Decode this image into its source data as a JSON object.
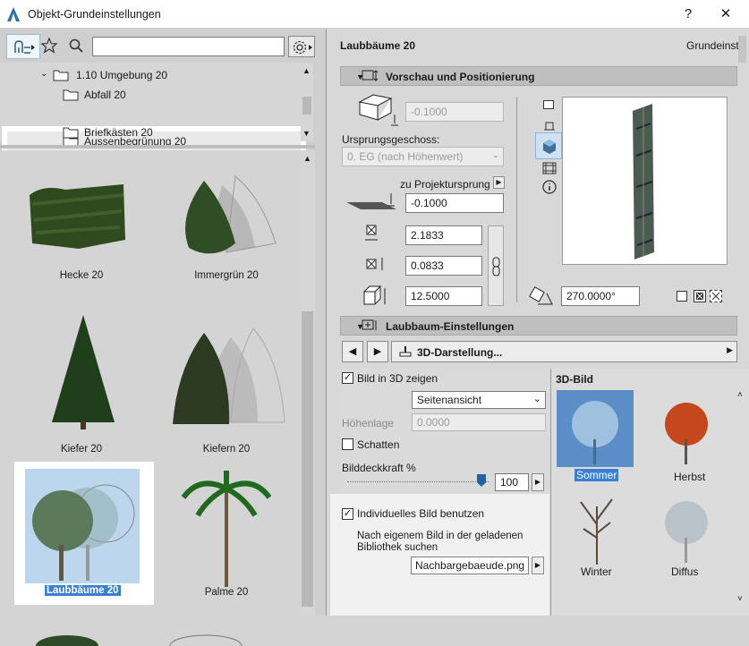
{
  "window": {
    "title": "Objekt-Grundeinstellungen",
    "help": "?",
    "close": "✕"
  },
  "left": {
    "tree": [
      {
        "label": "1.10 Umgebung 20"
      },
      {
        "label": "Abfall 20"
      },
      {
        "label": "Aussenbegrünung 20"
      },
      {
        "label": "Briefkästen 20"
      }
    ],
    "thumbs": [
      {
        "label": "Hecke 20"
      },
      {
        "label": "Immergrün 20"
      },
      {
        "label": "Kiefer 20"
      },
      {
        "label": "Kiefern 20"
      },
      {
        "label": "Laubbäume 20"
      },
      {
        "label": "Palme 20"
      }
    ]
  },
  "right": {
    "object_name": "Laubbäume 20",
    "mode": "Grundeinst.",
    "preview_section": "Vorschau und Positionierung",
    "elev_value": "-0.1000",
    "origin_label": "Ursprungsgeschoss:",
    "origin_value": "0. EG (nach Höhenwert)",
    "projekt_label": "zu Projektursprung",
    "projekt_value": "-0.1000",
    "width": "2.1833",
    "depth": "0.0833",
    "height": "12.5000",
    "angle": "270.0000°",
    "settings_section": "Laubbaum-Einstellungen",
    "nav_label": "3D-Darstellung...",
    "show3d_label": "Bild in 3D zeigen",
    "view_value": "Seitenansicht",
    "hoehenlage_label": "Höhenlage",
    "hoehenlage_value": "0.0000",
    "schatten_label": "Schatten",
    "deckkraft_label": "Bilddeckkraft %",
    "deckkraft_value": "100",
    "deckkraft_level": 1.0,
    "indiv_label": "Individuelles Bild benutzen",
    "search_label": "Nach eigenem Bild in der geladenen Bibliothek suchen",
    "file_value": "Nachbargebaeude.png",
    "bild_title": "3D-Bild",
    "seasons": [
      {
        "label": "Sommer"
      },
      {
        "label": "Herbst"
      },
      {
        "label": "Winter"
      },
      {
        "label": "Diffus"
      }
    ]
  }
}
